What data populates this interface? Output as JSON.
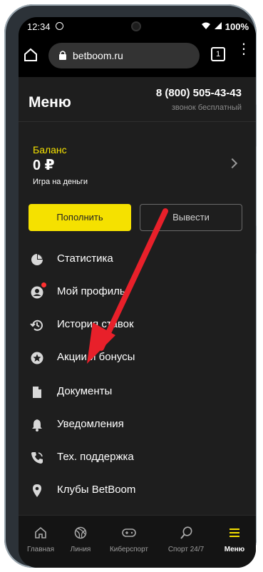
{
  "status_bar": {
    "time": "12:34",
    "battery": "100%"
  },
  "browser": {
    "url": "betboom.ru",
    "tabs_count": "1"
  },
  "header": {
    "title": "Меню",
    "phone": "8 (800) 505-43-43",
    "phone_note": "звонок бесплатный"
  },
  "balance": {
    "label": "Баланс",
    "value": "0 ₽",
    "note": "Игра на деньги",
    "deposit_label": "Пополнить",
    "withdraw_label": "Вывести"
  },
  "menu": [
    {
      "label": "Статистика",
      "icon": "pie-chart-icon"
    },
    {
      "label": "Мой профиль",
      "icon": "profile-icon"
    },
    {
      "label": "История ставок",
      "icon": "history-icon"
    },
    {
      "label": "Акции и бонусы",
      "icon": "star-icon"
    },
    {
      "label": "Документы",
      "icon": "document-icon"
    },
    {
      "label": "Уведомления",
      "icon": "bell-icon"
    },
    {
      "label": "Тех. поддержка",
      "icon": "phone-icon"
    },
    {
      "label": "Клубы BetBoom",
      "icon": "location-icon"
    }
  ],
  "bottom_nav": [
    {
      "label": "Главная",
      "icon": "home-icon"
    },
    {
      "label": "Линия",
      "icon": "ball-icon"
    },
    {
      "label": "Киберспорт",
      "icon": "gamepad-icon"
    },
    {
      "label": "Спорт 24/7",
      "icon": "racket-icon"
    },
    {
      "label": "Меню",
      "icon": "menu-icon"
    }
  ],
  "colors": {
    "accent": "#f5e100",
    "background": "#1e1e1e",
    "annotation_arrow": "#e8202a"
  }
}
